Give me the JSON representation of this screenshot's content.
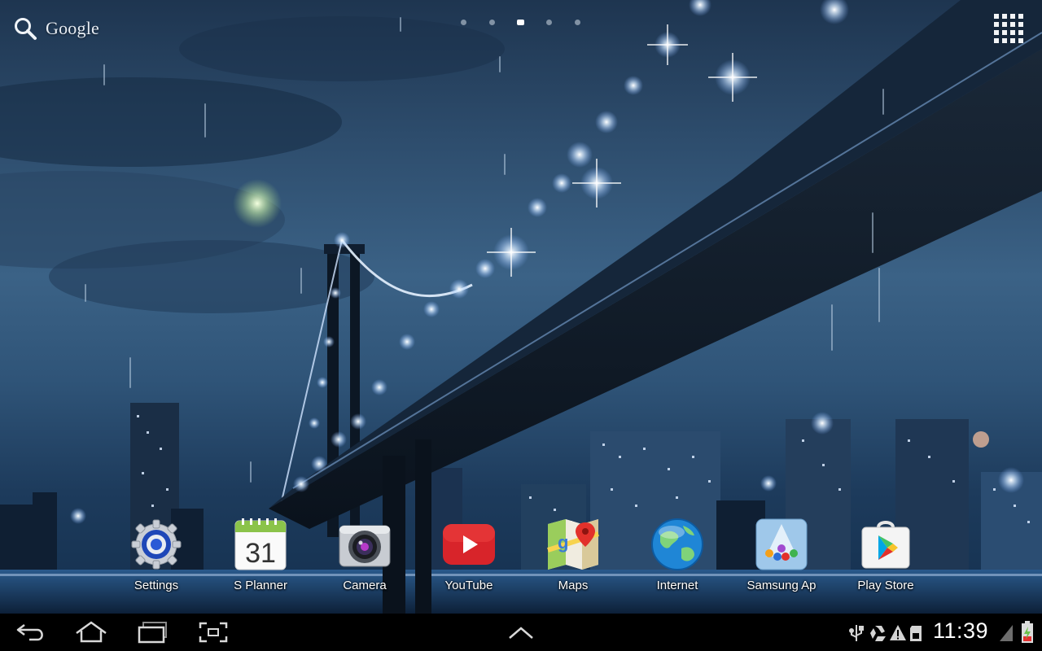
{
  "top_bar": {
    "search_label": "Google",
    "search_icon": "search-icon",
    "pages": {
      "count": 5,
      "active_index": 2
    },
    "apps_button_icon": "apps-grid-icon"
  },
  "dock": [
    {
      "label": "Settings",
      "icon": "settings-gear-icon"
    },
    {
      "label": "S Planner",
      "icon": "calendar-icon",
      "icon_text": "31"
    },
    {
      "label": "Camera",
      "icon": "camera-icon"
    },
    {
      "label": "YouTube",
      "icon": "youtube-icon"
    },
    {
      "label": "Maps",
      "icon": "maps-icon"
    },
    {
      "label": "Internet",
      "icon": "globe-icon"
    },
    {
      "label": "Samsung Ap",
      "icon": "samsung-apps-icon"
    },
    {
      "label": "Play Store",
      "icon": "play-store-icon"
    }
  ],
  "nav_bar": {
    "buttons": [
      "back-icon",
      "home-icon",
      "recent-apps-icon",
      "screenshot-icon"
    ],
    "center_icon": "chevron-up-icon",
    "status_icons": [
      "usb-icon",
      "recycle-icon",
      "warning-icon",
      "sd-card-icon"
    ],
    "time": "11:39",
    "signal_icon": "signal-icon",
    "battery_icon": "battery-charging-icon"
  },
  "colors": {
    "sky_top": "#1e3550",
    "sky_mid": "#3b6286",
    "nav_bar": "#000000",
    "youtube_red": "#d8242a",
    "calendar_green": "#8bc34a"
  }
}
